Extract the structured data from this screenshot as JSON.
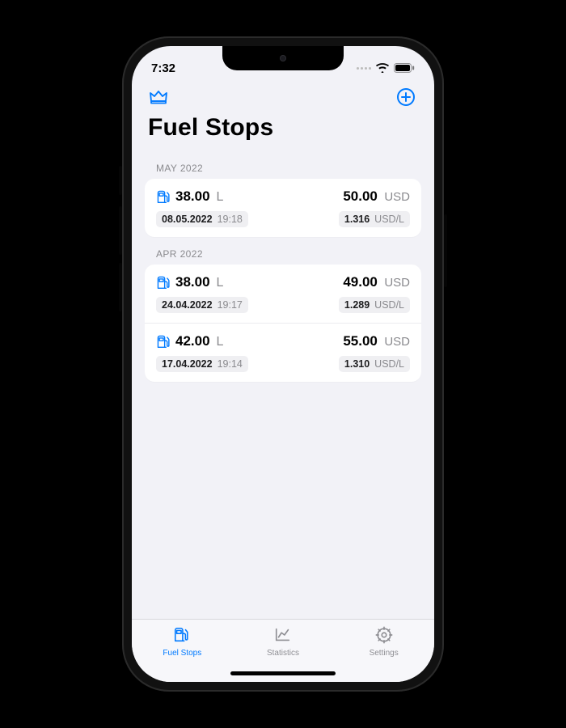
{
  "status": {
    "time": "7:32"
  },
  "accent": "#007aff",
  "toolbar": {
    "premium_icon": "crown-icon",
    "add_icon": "plus-circle-icon"
  },
  "page_title": "Fuel Stops",
  "sections": [
    {
      "header": "MAY 2022",
      "rows": [
        {
          "qty": "38.00",
          "qty_unit": "L",
          "price": "50.00",
          "currency": "USD",
          "date": "08.05.2022",
          "time": "19:18",
          "rate": "1.316",
          "rate_unit": "USD/L"
        }
      ]
    },
    {
      "header": "APR 2022",
      "rows": [
        {
          "qty": "38.00",
          "qty_unit": "L",
          "price": "49.00",
          "currency": "USD",
          "date": "24.04.2022",
          "time": "19:17",
          "rate": "1.289",
          "rate_unit": "USD/L"
        },
        {
          "qty": "42.00",
          "qty_unit": "L",
          "price": "55.00",
          "currency": "USD",
          "date": "17.04.2022",
          "time": "19:14",
          "rate": "1.310",
          "rate_unit": "USD/L"
        }
      ]
    }
  ],
  "tabs": [
    {
      "label": "Fuel Stops",
      "icon": "fuel-pump-icon",
      "active": true
    },
    {
      "label": "Statistics",
      "icon": "chart-line-icon",
      "active": false
    },
    {
      "label": "Settings",
      "icon": "gear-icon",
      "active": false
    }
  ]
}
